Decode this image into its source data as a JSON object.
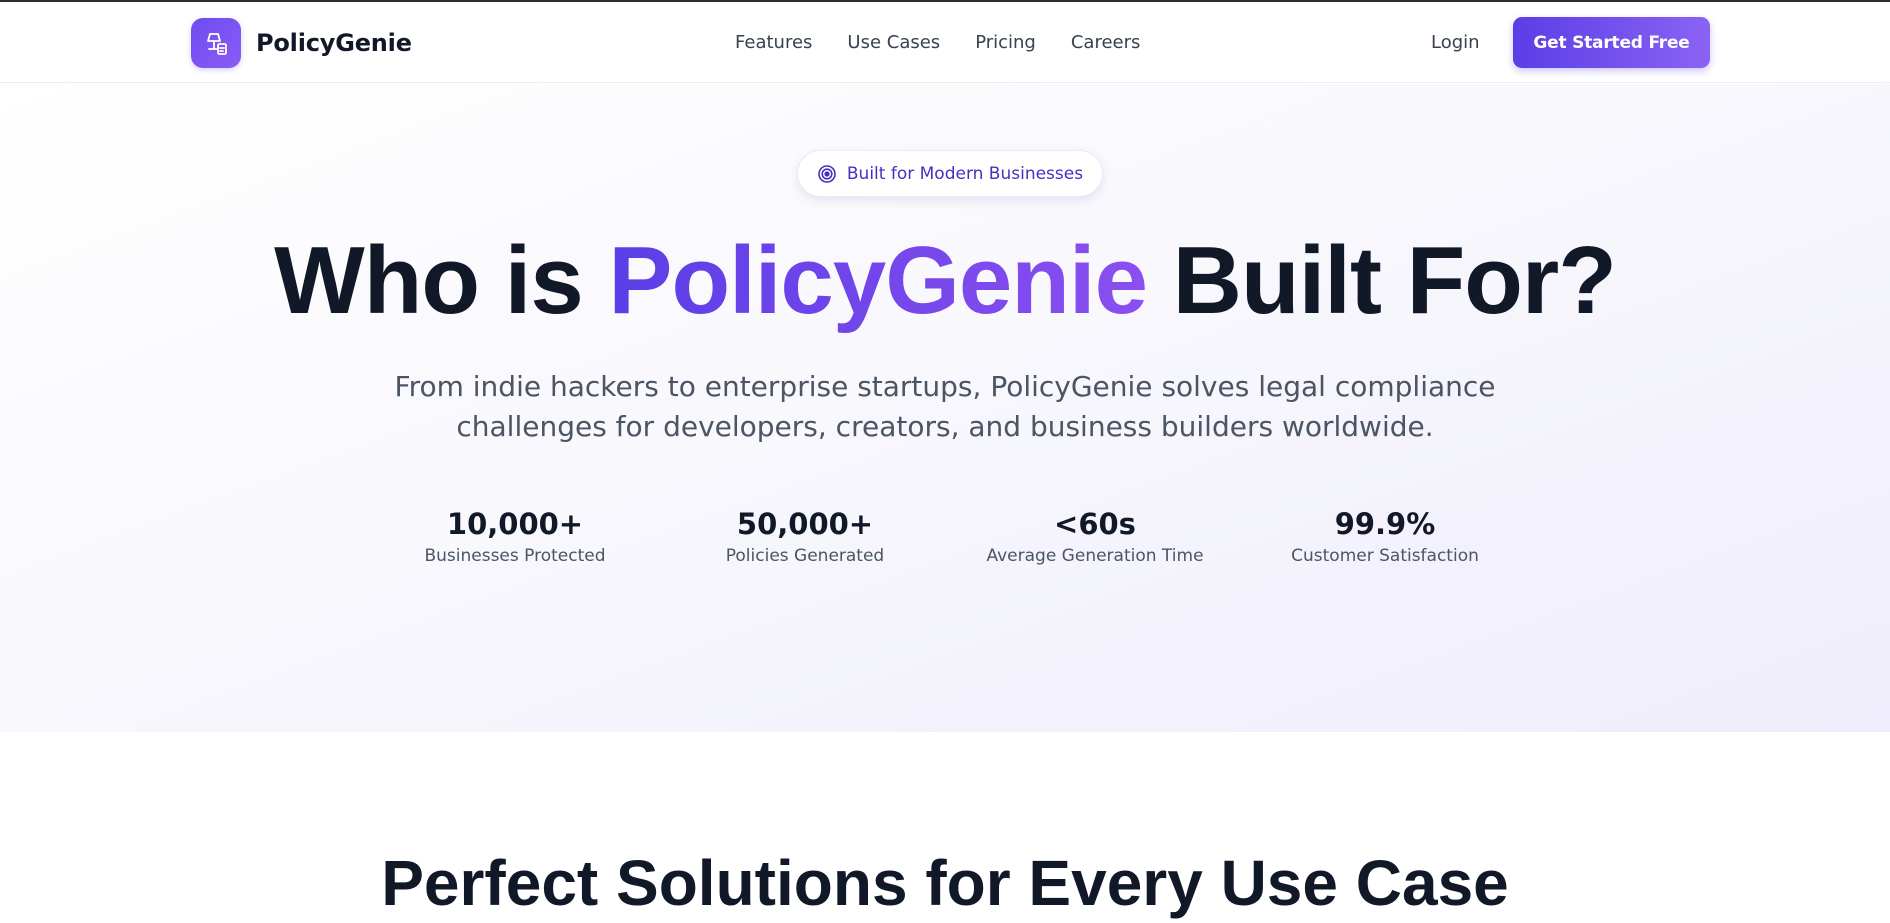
{
  "brand": {
    "name": "PolicyGenie",
    "logo_icon": "lamp-document-icon",
    "accent_color": "#5b3ee6",
    "accent_color_2": "#8b5cf6"
  },
  "nav": {
    "items": [
      {
        "label": "Features"
      },
      {
        "label": "Use Cases"
      },
      {
        "label": "Pricing"
      },
      {
        "label": "Careers"
      }
    ],
    "login_label": "Login",
    "cta_label": "Get Started Free"
  },
  "hero": {
    "badge": {
      "icon": "target-icon",
      "label": "Built for Modern Businesses"
    },
    "headline_start": "Who is ",
    "headline_accent": "PolicyGenie",
    "headline_end": " Built For?",
    "subtitle_line1": "From indie hackers to enterprise startups, PolicyGenie solves legal compliance",
    "subtitle_line2": "challenges for developers, creators, and business builders worldwide.",
    "stats": [
      {
        "value": "10,000+",
        "label": "Businesses Protected"
      },
      {
        "value": "50,000+",
        "label": "Policies Generated"
      },
      {
        "value": "<60s",
        "label": "Average Generation Time"
      },
      {
        "value": "99.9%",
        "label": "Customer Satisfaction"
      }
    ]
  },
  "section": {
    "title": "Perfect Solutions for Every Use Case"
  }
}
